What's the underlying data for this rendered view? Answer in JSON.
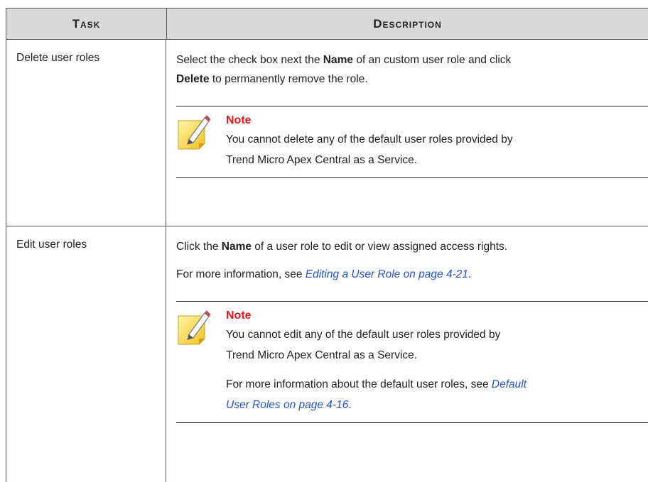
{
  "header": {
    "task": "Task",
    "description": "Description"
  },
  "rows": [
    {
      "task": "Delete user roles",
      "desc_pre": "Select the check box next the ",
      "desc_bold1": "Name",
      "desc_mid": " of an custom user role and click",
      "desc_bold2": "Delete",
      "desc_post": " to permanently remove the role.",
      "note_title": "Note",
      "note_line1": "You cannot delete any of the default user roles provided by",
      "note_line2": "Trend Micro Apex Central as a Service."
    },
    {
      "task": "Edit user roles",
      "desc_pre": "Click the ",
      "desc_bold1": "Name",
      "desc_post": " of a user role to edit or view assigned access rights.",
      "more_pre": "For more information, see ",
      "more_link": "Editing a User Role on page 4-21",
      "more_post": ".",
      "note_title": "Note",
      "note_line1": "You cannot edit any of the default user roles provided by",
      "note_line2": "Trend Micro Apex Central as a Service.",
      "note_more_pre": "For more information about the default user roles, see ",
      "note_more_link1": "Default",
      "note_more_link2": "User Roles on page 4-16",
      "note_more_post": "."
    }
  ]
}
